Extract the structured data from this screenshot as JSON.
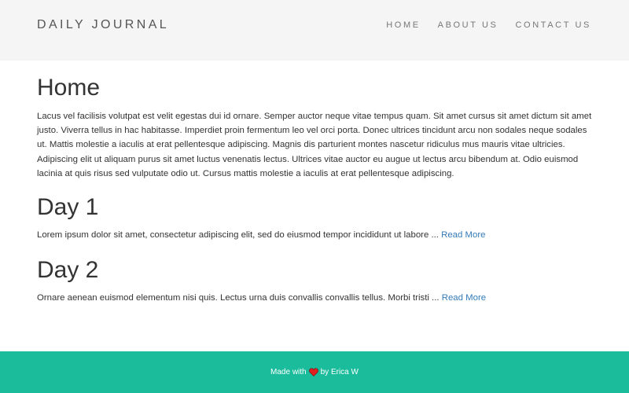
{
  "header": {
    "brand": "DAILY JOURNAL",
    "nav": [
      {
        "label": "HOME"
      },
      {
        "label": "ABOUT US"
      },
      {
        "label": "CONTACT US"
      }
    ]
  },
  "main": {
    "title": "Home",
    "intro": "Lacus vel facilisis volutpat est velit egestas dui id ornare. Semper auctor neque vitae tempus quam. Sit amet cursus sit amet dictum sit amet justo. Viverra tellus in hac habitasse. Imperdiet proin fermentum leo vel orci porta. Donec ultrices tincidunt arcu non sodales neque sodales ut. Mattis molestie a iaculis at erat pellentesque adipiscing. Magnis dis parturient montes nascetur ridiculus mus mauris vitae ultricies. Adipiscing elit ut aliquam purus sit amet luctus venenatis lectus. Ultrices vitae auctor eu augue ut lectus arcu bibendum at. Odio euismod lacinia at quis risus sed vulputate odio ut. Cursus mattis molestie a iaculis at erat pellentesque adipiscing.",
    "posts": [
      {
        "title": "Day 1",
        "excerpt": "Lorem ipsum dolor sit amet, consectetur adipiscing elit, sed do eiusmod tempor incididunt ut labore ...",
        "read_more": "Read More"
      },
      {
        "title": "Day 2",
        "excerpt": "Ornare aenean euismod elementum nisi quis. Lectus urna duis convallis convallis tellus. Morbi tristi ...",
        "read_more": "Read More"
      }
    ]
  },
  "footer": {
    "prefix": "Made with",
    "icon": "heart-icon",
    "suffix": "by Erica W"
  },
  "colors": {
    "header_bg": "#f5f5f5",
    "footer_bg": "#1abc9c",
    "link": "#337ab7",
    "heart": "#e02020"
  }
}
